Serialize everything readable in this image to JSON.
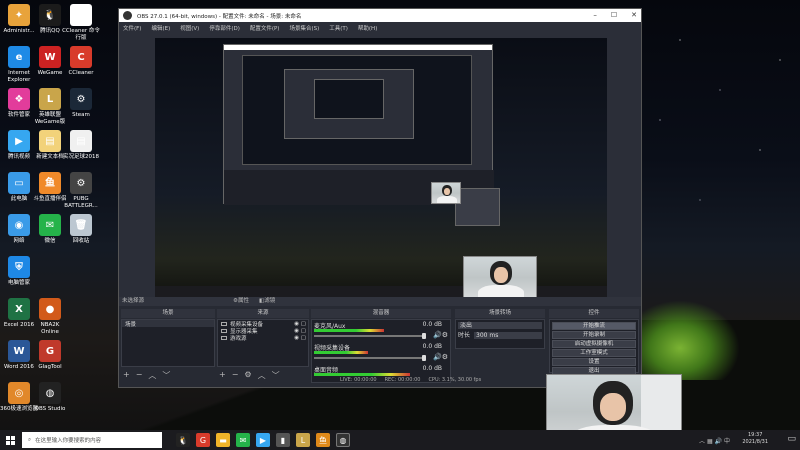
{
  "desktop": {
    "icons": [
      {
        "label": "Administr...",
        "col": "#e8a33b",
        "glyph": "✦"
      },
      {
        "label": "腾讯QQ",
        "col": "#1b1b1b",
        "glyph": "🐧"
      },
      {
        "label": "CCleaner 命令行版",
        "col": "#ffffff",
        "glyph": "▤"
      },
      {
        "label": "Internet Explorer",
        "col": "#1e8ae6",
        "glyph": "e"
      },
      {
        "label": "WeGame",
        "col": "#cc2222",
        "glyph": "W"
      },
      {
        "label": "CCleaner",
        "col": "#d83b2b",
        "glyph": "C"
      },
      {
        "label": "软件管家",
        "col": "#e23c9b",
        "glyph": "❖"
      },
      {
        "label": "英雄联盟 WeGame版",
        "col": "#c9a54a",
        "glyph": "L"
      },
      {
        "label": "Steam",
        "col": "#1b2838",
        "glyph": "⚙"
      },
      {
        "label": "腾讯视频",
        "col": "#36a7f0",
        "glyph": "▶"
      },
      {
        "label": "新建文本档",
        "col": "#f2d27a",
        "glyph": "▤"
      },
      {
        "label": "实况足球2018",
        "col": "#f0f0f0",
        "glyph": "▤"
      },
      {
        "label": "此电脑",
        "col": "#3a9be8",
        "glyph": "▭"
      },
      {
        "label": "斗鱼直播伴侣",
        "col": "#f08a2a",
        "glyph": "鱼"
      },
      {
        "label": "PUBG BATTLEGR...",
        "col": "#444444",
        "glyph": "⚙"
      },
      {
        "label": "网络",
        "col": "#3a9be8",
        "glyph": "◉"
      },
      {
        "label": "微信",
        "col": "#25b34a",
        "glyph": "✉"
      },
      {
        "label": "回收站",
        "col": "#bcc7d1",
        "glyph": "🗑"
      },
      {
        "label": "电脑管家",
        "col": "#1e88e5",
        "glyph": "⛨"
      },
      {
        "label": "Excel 2016",
        "col": "#1f7244",
        "glyph": "X"
      },
      {
        "label": "NBA2K Online",
        "col": "#d25a1a",
        "glyph": "●"
      },
      {
        "label": "Word 2016",
        "col": "#2b5797",
        "glyph": "W"
      },
      {
        "label": "GlagTool",
        "col": "#c0392b",
        "glyph": "G"
      },
      {
        "label": "360极速浏览器",
        "col": "#e1882a",
        "glyph": "◎"
      },
      {
        "label": "OBS Studio",
        "col": "#222222",
        "glyph": "◍"
      }
    ]
  },
  "obs": {
    "title": "OBS 27.0.1 (64-bit, windows) - 配置文件: 未命名 - 场景: 未命名",
    "menu": [
      "文件(F)",
      "编辑(E)",
      "视图(V)",
      "停靠部件(D)",
      "配置文件(P)",
      "场景集合(S)",
      "工具(T)",
      "帮助(H)"
    ],
    "no_source": "未选择源",
    "props_btn": "属性",
    "filters_btn": "滤镜",
    "docks": {
      "scenes": {
        "title": "场景",
        "items": [
          "场景"
        ]
      },
      "sources": {
        "title": "来源",
        "items": [
          "视频采集设备",
          "显示器采集",
          "游戏源"
        ]
      },
      "mixer": {
        "title": "混音器",
        "channels": [
          {
            "name": "麦克风/Aux",
            "db": "0.0 dB"
          },
          {
            "name": "视频采集设备",
            "db": "0.0 dB"
          },
          {
            "name": "桌面音频",
            "db": "0.0 dB"
          }
        ]
      },
      "transitions": {
        "title": "场景转场",
        "type": "淡出",
        "duration_label": "时长",
        "duration": "300 ms"
      },
      "controls": {
        "title": "控件",
        "buttons": [
          "开始推流",
          "开始录制",
          "启动虚拟摄像机",
          "工作室模式",
          "设置",
          "退出"
        ]
      }
    },
    "status": {
      "live": "LIVE: 00:00:00",
      "rec": "REC: 00:00:00",
      "cpu": "CPU: 3.1%, 30.00 fps"
    }
  },
  "taskbar": {
    "search_placeholder": "在这里输入你要搜索的内容",
    "time": "19:37",
    "date": "2021/8/31"
  }
}
